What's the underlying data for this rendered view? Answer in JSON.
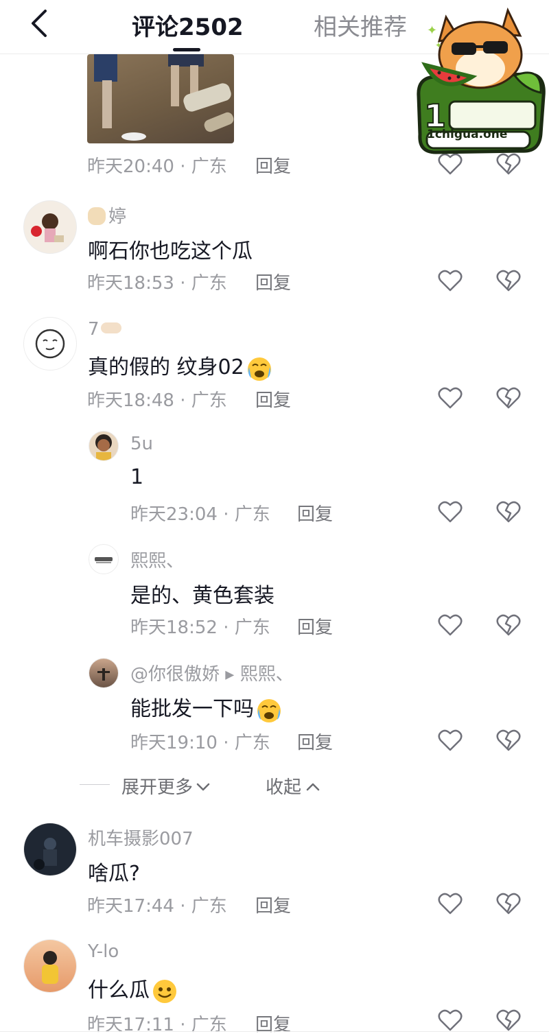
{
  "header": {
    "tab_comments": "评论2502",
    "tab_related": "相关推荐"
  },
  "watermark": {
    "url": "1chigua.one"
  },
  "comments": [
    {
      "meta": "昨天20:40 · 广东",
      "reply": "回复"
    },
    {
      "name": "婷",
      "content": "啊石你也吃这个瓜",
      "meta": "昨天18:53 · 广东",
      "reply": "回复"
    },
    {
      "name": "7",
      "content": "真的假的 纹身02",
      "meta": "昨天18:48 · 广东",
      "reply": "回复"
    },
    {
      "name": "5u",
      "content": "1",
      "meta": "昨天23:04 · 广东",
      "reply": "回复"
    },
    {
      "name": "熙熙、",
      "content": "是的、黄色套装",
      "meta": "昨天18:52 · 广东",
      "reply": "回复"
    },
    {
      "name": "@你很傲娇 ▸ 熙熙、",
      "content": "能批发一下吗",
      "meta": "昨天19:10 · 广东",
      "reply": "回复"
    },
    {
      "name": "机车摄影007",
      "content": "啥瓜?",
      "meta": "昨天17:44 · 广东",
      "reply": "回复"
    },
    {
      "name": "Y-lo",
      "content": "什么瓜",
      "meta": "昨天17:11 · 广东",
      "reply": "回复"
    }
  ],
  "thread_controls": {
    "expand_more": "展开更多",
    "collapse": "收起"
  },
  "icons": [
    "back-icon",
    "heart-icon",
    "broken-heart-icon",
    "chevron-down-icon",
    "chevron-up-icon"
  ],
  "colors": {
    "text": "#161823",
    "muted": "#9a9ba0",
    "accent": "#161823"
  }
}
